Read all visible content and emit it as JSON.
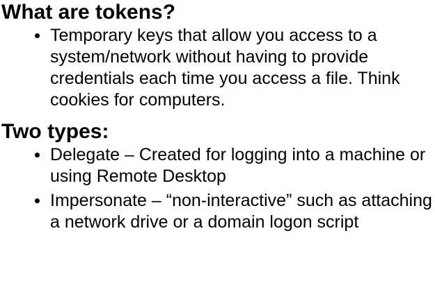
{
  "sections": [
    {
      "heading": "What are tokens?",
      "bullets": [
        "Temporary keys that allow you access to a system/network without having to provide credentials each time you access a file. Think cookies for computers."
      ]
    },
    {
      "heading": "Two types:",
      "bullets": [
        "Delegate – Created for logging into a machine or using Remote Desktop",
        "Impersonate – “non-interactive” such as attaching a network drive or a domain logon script"
      ]
    }
  ]
}
